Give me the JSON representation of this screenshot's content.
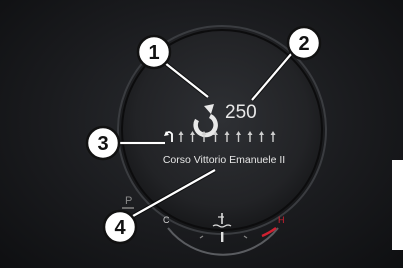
{
  "navigation": {
    "distance": "250",
    "street_name": "Corso Vittorio Emanuele II",
    "maneuver_icon": "turn-right-arrow-icon",
    "lane_guidance": {
      "lane_count": 10,
      "highlighted_lane": 1
    }
  },
  "gauge": {
    "cold_label": "C",
    "hot_label": "H",
    "icon": "coolant-temperature-icon"
  },
  "gear_indicator": "P",
  "callouts": [
    {
      "number": "1"
    },
    {
      "number": "2"
    },
    {
      "number": "3"
    },
    {
      "number": "4"
    }
  ],
  "colors": {
    "display_background": "#1b1c1f",
    "callout_fill": "#ffffff",
    "gauge_hot": "#d02030"
  }
}
